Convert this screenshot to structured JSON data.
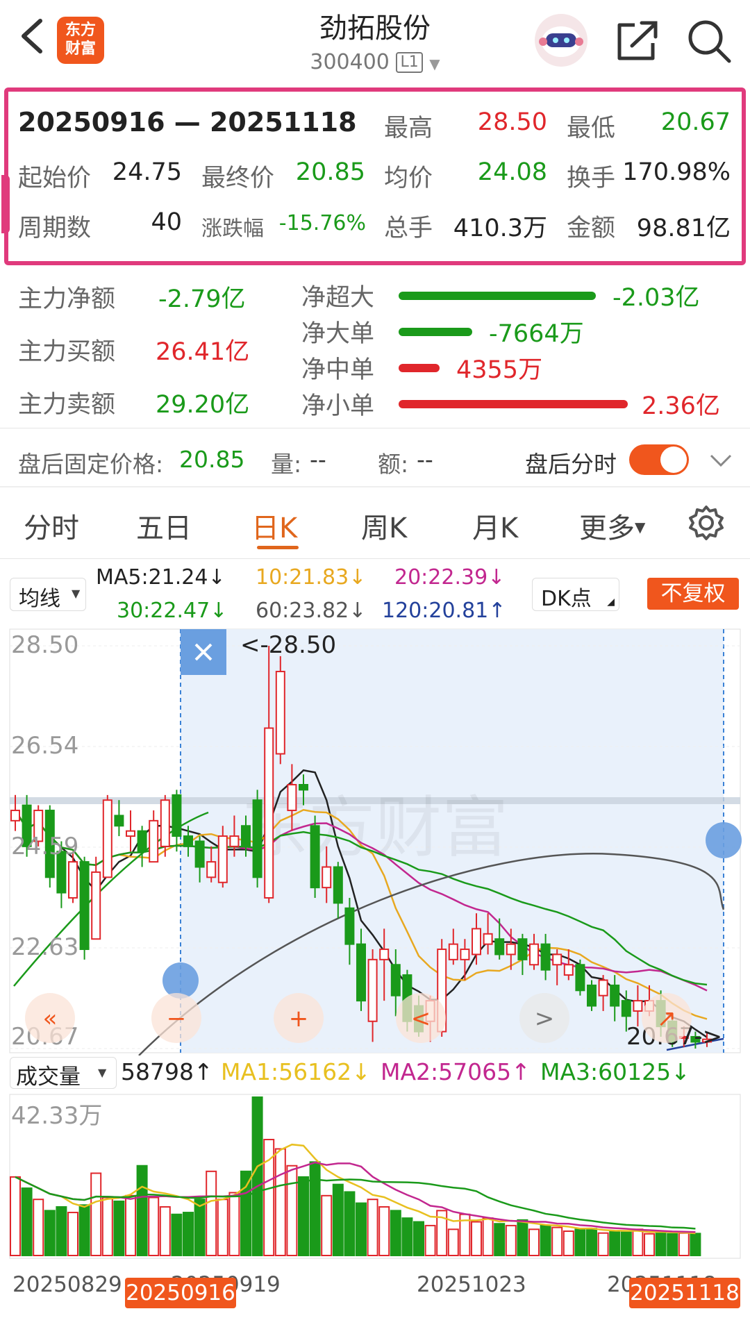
{
  "header": {
    "stock_name": "劲拓股份",
    "stock_code": "300400",
    "level": "L1",
    "logo_text_1": "东方",
    "logo_text_2": "财富"
  },
  "summary": {
    "date_range": "20250916 — 20251118",
    "high_label": "最高",
    "high": "28.50",
    "low_label": "最低",
    "low": "20.67",
    "start_label": "起始价",
    "start": "24.75",
    "end_label": "最终价",
    "end": "20.85",
    "avg_label": "均价",
    "avg": "24.08",
    "turnover_label": "换手",
    "turnover": "170.98%",
    "periods_label": "周期数",
    "periods": "40",
    "change_label": "涨跌幅",
    "change": "-15.76%",
    "volume_label": "总手",
    "volume": "410.3万",
    "amount_label": "金额",
    "amount": "98.81亿"
  },
  "flow": {
    "main_net_label": "主力净额",
    "main_net": "-2.79亿",
    "main_buy_label": "主力买额",
    "main_buy": "26.41亿",
    "main_sell_label": "主力卖额",
    "main_sell": "29.20亿",
    "items": [
      {
        "label": "净超大",
        "value": "-2.03亿",
        "ratio": 0.86,
        "sign": "neg"
      },
      {
        "label": "净大单",
        "value": "-7664万",
        "ratio": 0.32,
        "sign": "neg"
      },
      {
        "label": "净中单",
        "value": "4355万",
        "ratio": 0.18,
        "sign": "pos"
      },
      {
        "label": "净小单",
        "value": "2.36亿",
        "ratio": 1.0,
        "sign": "pos"
      }
    ]
  },
  "after_hours": {
    "price_label": "盘后固定价格:",
    "price": "20.85",
    "vol_label": "量:",
    "vol": "--",
    "amt_label": "额:",
    "amt": "--",
    "toggle_label": "盘后分时",
    "toggle_on": true
  },
  "tabs": [
    "分时",
    "五日",
    "日K",
    "周K",
    "月K",
    "更多"
  ],
  "active_tab": "日K",
  "ma_bar": {
    "select": "均线",
    "ma5": "MA5:21.24↓",
    "ma10": "10:21.83↓",
    "ma20": "20:22.39↓",
    "ma30": "30:22.47↓",
    "ma60": "60:23.82↓",
    "ma120": "120:20.81↑",
    "dk": "DK点",
    "fq": "不复权"
  },
  "kline": {
    "y_labels": [
      "28.50",
      "26.54",
      "24.59",
      "22.63",
      "20.67"
    ],
    "high_marker": "<-28.50",
    "low_marker": "20.67->",
    "watermark": "东方财富"
  },
  "volume_bar": {
    "select": "成交量",
    "current": "58798↑",
    "ma1": "MA1:56162↓",
    "ma2": "MA2:57065↑",
    "ma3": "MA3:60125↓",
    "max_label": "42.33万"
  },
  "dates": {
    "d1": "20250829",
    "d2": "20250919",
    "d3": "20251023",
    "d4": "20251118",
    "sel_start": "20250916",
    "sel_end": "20251118"
  },
  "colors": {
    "up": "#e0262b",
    "down": "#1a9a1a",
    "accent": "#e0661c",
    "highlight": "#e03a7c"
  },
  "chart_data": {
    "type": "candlestick",
    "price_range": [
      20.67,
      28.5
    ],
    "candles": [
      {
        "o": 25.1,
        "c": 25.3,
        "h": 25.6,
        "l": 24.9
      },
      {
        "o": 25.4,
        "c": 24.6,
        "h": 25.6,
        "l": 24.4
      },
      {
        "o": 24.7,
        "c": 25.3,
        "h": 25.4,
        "l": 24.6
      },
      {
        "o": 25.3,
        "c": 24.0,
        "h": 25.4,
        "l": 23.8
      },
      {
        "o": 24.5,
        "c": 23.7,
        "h": 24.7,
        "l": 23.4
      },
      {
        "o": 23.6,
        "c": 24.3,
        "h": 24.5,
        "l": 23.5
      },
      {
        "o": 24.3,
        "c": 22.6,
        "h": 24.4,
        "l": 22.4
      },
      {
        "o": 22.8,
        "c": 24.1,
        "h": 24.4,
        "l": 22.8
      },
      {
        "o": 24.0,
        "c": 25.5,
        "h": 25.6,
        "l": 24.0
      },
      {
        "o": 25.2,
        "c": 25.0,
        "h": 25.5,
        "l": 24.8
      },
      {
        "o": 24.8,
        "c": 24.9,
        "h": 25.3,
        "l": 24.5
      },
      {
        "o": 24.9,
        "c": 24.5,
        "h": 25.0,
        "l": 24.2
      },
      {
        "o": 24.3,
        "c": 25.1,
        "h": 25.3,
        "l": 24.3
      },
      {
        "o": 24.6,
        "c": 25.5,
        "h": 25.6,
        "l": 24.4
      },
      {
        "o": 25.6,
        "c": 24.8,
        "h": 25.7,
        "l": 24.5
      },
      {
        "o": 24.8,
        "c": 24.6,
        "h": 25.0,
        "l": 24.4
      },
      {
        "o": 24.7,
        "c": 24.2,
        "h": 24.8,
        "l": 23.9
      },
      {
        "o": 24.0,
        "c": 24.3,
        "h": 24.6,
        "l": 23.9
      },
      {
        "o": 23.9,
        "c": 24.8,
        "h": 25.0,
        "l": 23.8
      },
      {
        "o": 24.6,
        "c": 24.8,
        "h": 25.2,
        "l": 24.4
      },
      {
        "o": 25.0,
        "c": 24.6,
        "h": 25.2,
        "l": 24.4
      },
      {
        "o": 25.5,
        "c": 24.0,
        "h": 25.7,
        "l": 23.8
      },
      {
        "o": 23.6,
        "c": 26.9,
        "h": 28.5,
        "l": 23.5
      },
      {
        "o": 26.4,
        "c": 28.0,
        "h": 28.3,
        "l": 26.2
      },
      {
        "o": 25.3,
        "c": 25.8,
        "h": 26.2,
        "l": 24.9
      },
      {
        "o": 25.8,
        "c": 25.7,
        "h": 26.0,
        "l": 25.4
      },
      {
        "o": 25.0,
        "c": 23.8,
        "h": 25.2,
        "l": 23.6
      },
      {
        "o": 23.8,
        "c": 24.2,
        "h": 24.6,
        "l": 23.5
      },
      {
        "o": 24.2,
        "c": 23.5,
        "h": 24.3,
        "l": 23.2
      },
      {
        "o": 23.4,
        "c": 22.7,
        "h": 23.6,
        "l": 22.3
      },
      {
        "o": 22.7,
        "c": 21.6,
        "h": 23.0,
        "l": 21.4
      },
      {
        "o": 21.2,
        "c": 22.4,
        "h": 22.6,
        "l": 20.8
      },
      {
        "o": 22.4,
        "c": 22.6,
        "h": 23.0,
        "l": 21.6
      },
      {
        "o": 22.3,
        "c": 21.7,
        "h": 22.6,
        "l": 21.3
      },
      {
        "o": 22.1,
        "c": 21.2,
        "h": 22.2,
        "l": 21.0
      },
      {
        "o": 21.5,
        "c": 21.0,
        "h": 21.7,
        "l": 20.9
      },
      {
        "o": 21.2,
        "c": 21.6,
        "h": 21.7,
        "l": 20.8
      },
      {
        "o": 21.0,
        "c": 22.6,
        "h": 22.8,
        "l": 20.9
      },
      {
        "o": 22.4,
        "c": 22.7,
        "h": 23.0,
        "l": 22.3
      },
      {
        "o": 22.4,
        "c": 22.6,
        "h": 22.8,
        "l": 22.0
      },
      {
        "o": 22.5,
        "c": 23.0,
        "h": 23.3,
        "l": 22.3
      },
      {
        "o": 22.7,
        "c": 22.9,
        "h": 23.3,
        "l": 22.5
      },
      {
        "o": 22.8,
        "c": 22.5,
        "h": 23.2,
        "l": 22.4
      },
      {
        "o": 22.5,
        "c": 22.7,
        "h": 23.0,
        "l": 22.2
      },
      {
        "o": 22.8,
        "c": 22.4,
        "h": 22.9,
        "l": 22.1
      },
      {
        "o": 22.3,
        "c": 22.7,
        "h": 22.9,
        "l": 22.2
      },
      {
        "o": 22.7,
        "c": 22.2,
        "h": 22.9,
        "l": 22.0
      },
      {
        "o": 22.3,
        "c": 22.5,
        "h": 22.6,
        "l": 21.9
      },
      {
        "o": 22.1,
        "c": 22.3,
        "h": 22.6,
        "l": 22.0
      },
      {
        "o": 22.3,
        "c": 21.8,
        "h": 22.4,
        "l": 21.7
      },
      {
        "o": 21.9,
        "c": 21.5,
        "h": 22.0,
        "l": 21.4
      },
      {
        "o": 21.7,
        "c": 22.0,
        "h": 22.1,
        "l": 21.4
      },
      {
        "o": 21.9,
        "c": 21.5,
        "h": 22.1,
        "l": 21.2
      },
      {
        "o": 21.6,
        "c": 21.3,
        "h": 21.8,
        "l": 21.0
      },
      {
        "o": 21.4,
        "c": 21.6,
        "h": 21.9,
        "l": 21.1
      },
      {
        "o": 21.4,
        "c": 21.6,
        "h": 21.9,
        "l": 21.3
      },
      {
        "o": 21.6,
        "c": 21.1,
        "h": 21.8,
        "l": 20.9
      },
      {
        "o": 21.2,
        "c": 20.8,
        "h": 21.3,
        "l": 20.7
      },
      {
        "o": 20.9,
        "c": 20.9,
        "h": 21.1,
        "l": 20.7
      },
      {
        "o": 20.9,
        "c": 20.8,
        "h": 21.0,
        "l": 20.67
      },
      {
        "o": 20.8,
        "c": 20.85,
        "h": 21.0,
        "l": 20.7
      }
    ],
    "volumes": [
      210000,
      180000,
      150000,
      120000,
      130000,
      115000,
      135000,
      220000,
      155000,
      145000,
      160000,
      240000,
      155000,
      130000,
      110000,
      115000,
      150000,
      225000,
      150000,
      168000,
      225000,
      423300,
      310000,
      285000,
      240000,
      210000,
      250000,
      160000,
      190000,
      170000,
      140000,
      150000,
      130000,
      120000,
      100000,
      90000,
      80000,
      120000,
      70000,
      110000,
      90000,
      100000,
      85000,
      80000,
      95000,
      70000,
      80000,
      75000,
      65000,
      70000,
      72000,
      60000,
      65000,
      62000,
      70000,
      58000,
      62000,
      58000,
      60000,
      58798
    ]
  }
}
